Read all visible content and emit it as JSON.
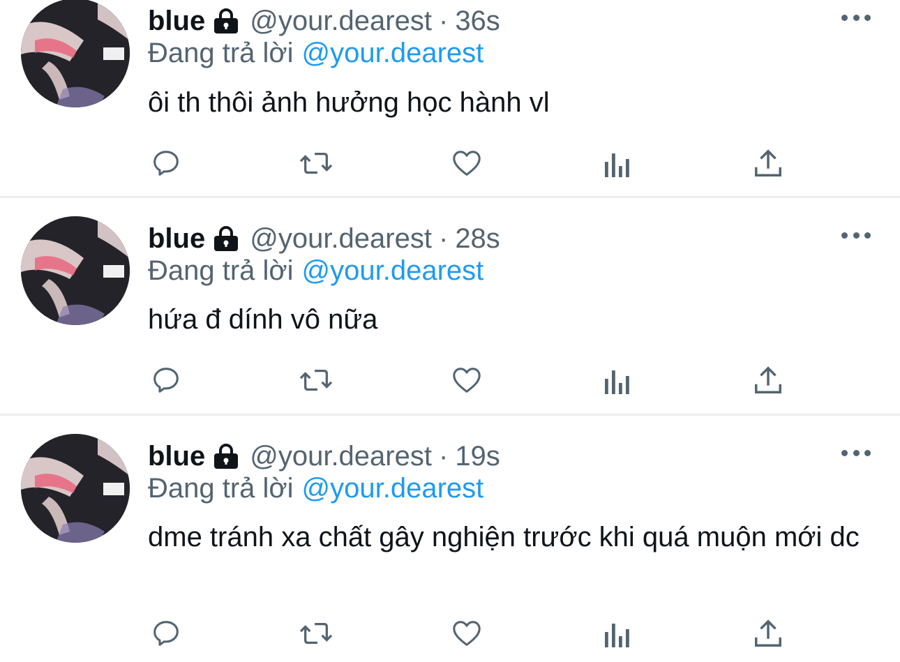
{
  "tweets": [
    {
      "display_name": "blue",
      "handle": "@your.dearest",
      "separator": "·",
      "time": "36s",
      "reply_prefix": "Đang trả lời",
      "reply_to": "@your.dearest",
      "text": "ôi th thôi ảnh hưởng học hành vl"
    },
    {
      "display_name": "blue",
      "handle": "@your.dearest",
      "separator": "·",
      "time": "28s",
      "reply_prefix": "Đang trả lời",
      "reply_to": "@your.dearest",
      "text": "hứa đ dính vô nữa"
    },
    {
      "display_name": "blue",
      "handle": "@your.dearest",
      "separator": "·",
      "time": "19s",
      "reply_prefix": "Đang trả lời",
      "reply_to": "@your.dearest",
      "text": "dme tránh xa chất gây nghiện trước khi quá muộn mới dc"
    }
  ],
  "icons": {
    "lock": "lock-icon",
    "more": "more-horizontal-icon",
    "reply": "reply-icon",
    "retweet": "retweet-icon",
    "like": "heart-icon",
    "views": "views-chart-icon",
    "share": "share-icon"
  },
  "colors": {
    "text": "#0f1419",
    "secondary": "#536471",
    "link": "#1d9bf0",
    "divider": "#eceeef",
    "avatar_accent": "#e8607a"
  }
}
